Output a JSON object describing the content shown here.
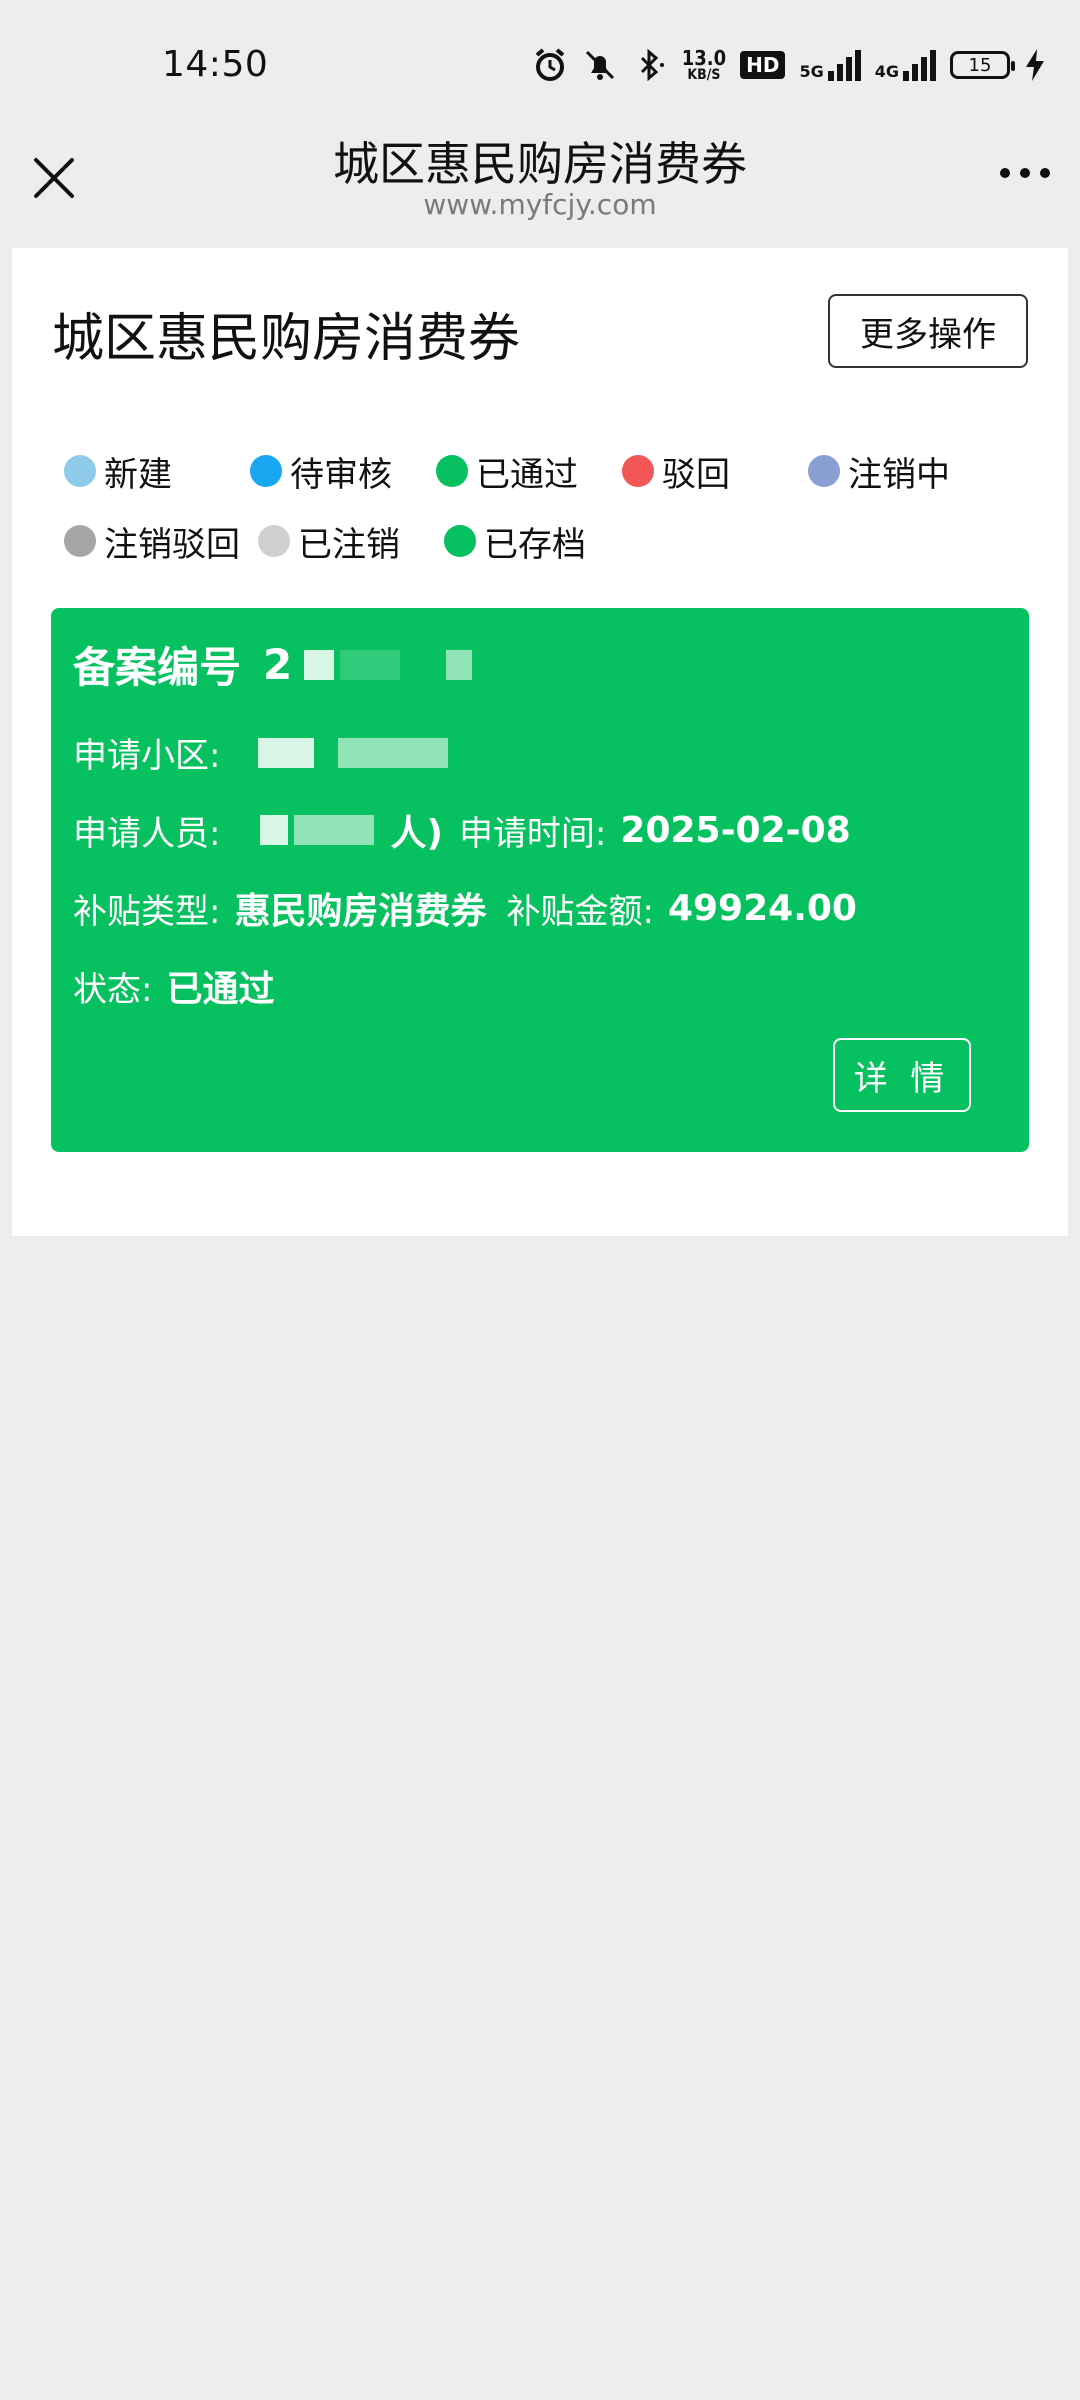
{
  "status_bar": {
    "time": "14:50",
    "net_speed_value": "13.0",
    "net_speed_unit": "KB/S",
    "hd_label": "HD",
    "net1_label": "5G",
    "net2_label": "4G",
    "battery_level": "15"
  },
  "navbar": {
    "title": "城区惠民购房消费券",
    "url": "www.myfcjy.com"
  },
  "page": {
    "title": "城区惠民购房消费券",
    "more_button": "更多操作"
  },
  "legend": {
    "row1": [
      {
        "label": "新建",
        "color": "#8ecbea"
      },
      {
        "label": "待审核",
        "color": "#18a7f0"
      },
      {
        "label": "已通过",
        "color": "#07c160"
      },
      {
        "label": "驳回",
        "color": "#f35656"
      },
      {
        "label": "注销中",
        "color": "#8aa0d2"
      }
    ],
    "row2": [
      {
        "label": "注销驳回",
        "color": "#a6a6a6"
      },
      {
        "label": "已注销",
        "color": "#cfcfcf"
      },
      {
        "label": "已存档",
        "color": "#07c160"
      }
    ]
  },
  "record": {
    "number_label": "备案编号",
    "number_value_visible": "2",
    "community_label": "申请小区:",
    "applicant_label": "申请人员:",
    "applicant_suffix": "人)",
    "apply_time_label": "申请时间:",
    "apply_time_value": "2025-02-08",
    "subsidy_type_label": "补贴类型:",
    "subsidy_type_value": "惠民购房消费券",
    "subsidy_amount_label": "补贴金额:",
    "subsidy_amount_value": "49924.00",
    "status_label": "状态:",
    "status_value": "已通过",
    "detail_button": "详 情",
    "card_color": "#07c160"
  }
}
